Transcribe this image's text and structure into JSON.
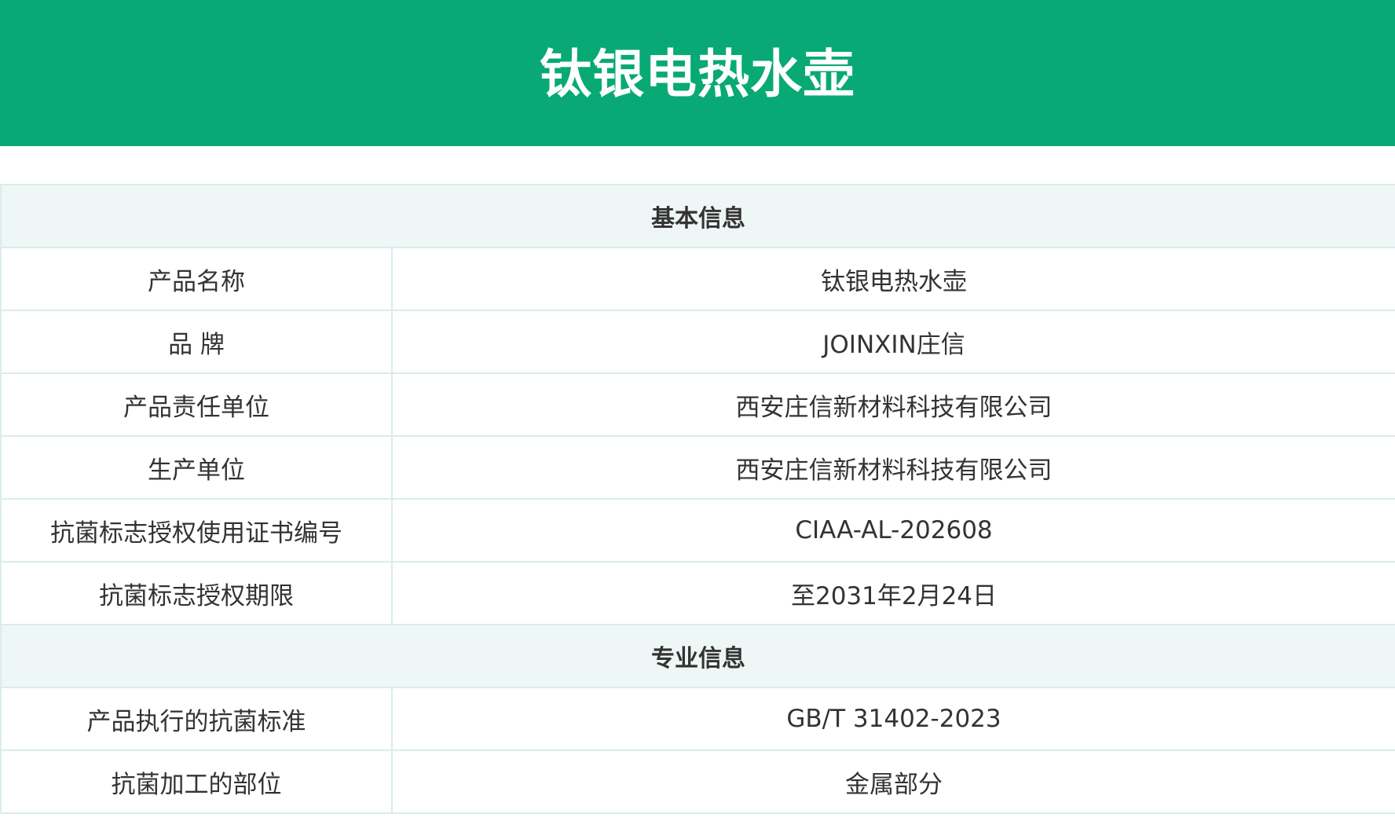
{
  "header": {
    "title": "钛银电热水壶"
  },
  "colors": {
    "header_bg": "#08a975",
    "section_bg": "#eef7f6",
    "border": "#dbeceb",
    "text": "#333333"
  },
  "sections": [
    {
      "title": "基本信息",
      "rows": [
        {
          "label": "产品名称",
          "value": "钛银电热水壶"
        },
        {
          "label": "品 牌",
          "value": "JOINXIN庄信"
        },
        {
          "label": "产品责任单位",
          "value": "西安庄信新材料科技有限公司"
        },
        {
          "label": "生产单位",
          "value": "西安庄信新材料科技有限公司"
        },
        {
          "label": "抗菌标志授权使用证书编号",
          "value": "CIAA-AL-202608"
        },
        {
          "label": "抗菌标志授权期限",
          "value": "至2031年2月24日"
        }
      ]
    },
    {
      "title": "专业信息",
      "rows": [
        {
          "label": "产品执行的抗菌标准",
          "value": "GB/T 31402-2023"
        },
        {
          "label": "抗菌加工的部位",
          "value": "金属部分"
        }
      ]
    }
  ]
}
